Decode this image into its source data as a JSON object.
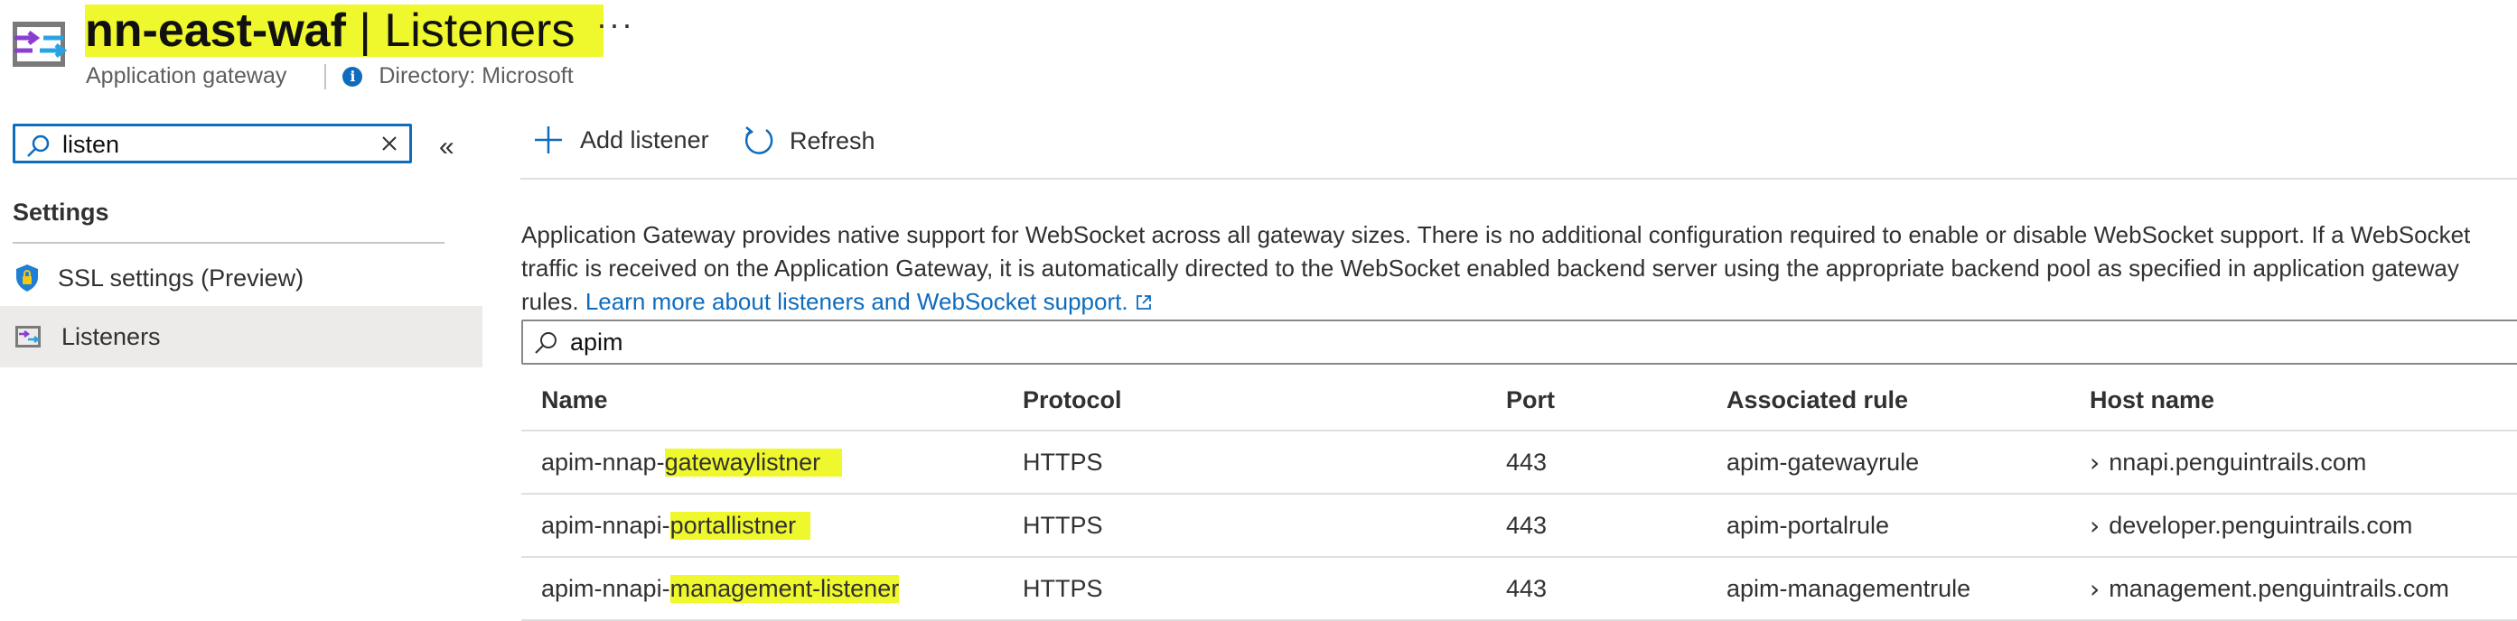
{
  "header": {
    "resource_name": "nn-east-waf",
    "separator": " | ",
    "page_title": "Listeners",
    "more_label": "···",
    "subtitle": "Application gateway",
    "directory": "Directory: Microsoft"
  },
  "search": {
    "value": "listen"
  },
  "nav": {
    "section": "Settings",
    "items": [
      {
        "label": "SSL settings (Preview)",
        "icon": "shield-lock-icon"
      },
      {
        "label": "Listeners",
        "icon": "listeners-icon",
        "selected": true
      }
    ]
  },
  "toolbar": {
    "add_label": "Add listener",
    "refresh_label": "Refresh"
  },
  "description": {
    "line1": "Application Gateway provides native support for WebSocket across all gateway sizes. There is no additional configuration required to enable or disable WebSocket support. If a WebSocket",
    "line2": "traffic is received on the Application Gateway, it is automatically directed to the WebSocket enabled backend server using the appropriate backend pool as specified in application gateway",
    "line3_prefix": "rules.",
    "link": "Learn more about listeners and WebSocket support."
  },
  "filter": {
    "value": "apim"
  },
  "table": {
    "columns": [
      "Name",
      "Protocol",
      "Port",
      "Associated rule",
      "Host name"
    ],
    "rows": [
      {
        "name_prefix": "apim-nnap-",
        "name_match": "gatewaylistner",
        "protocol": "HTTPS",
        "port": "443",
        "rule": "apim-gatewayrule",
        "host": "nnapi.penguintrails.com"
      },
      {
        "name_prefix": "apim-nnapi-",
        "name_match": "portallistner",
        "protocol": "HTTPS",
        "port": "443",
        "rule": "apim-portalrule",
        "host": "developer.penguintrails.com"
      },
      {
        "name_prefix": "apim-nnapi-",
        "name_match": "management-listener",
        "protocol": "HTTPS",
        "port": "443",
        "rule": "apim-managementrule",
        "host": "management.penguintrails.com"
      }
    ]
  },
  "colors": {
    "accent": "#0f6cbd",
    "highlight": "#eef82c",
    "selected_bg": "#edebe9"
  }
}
